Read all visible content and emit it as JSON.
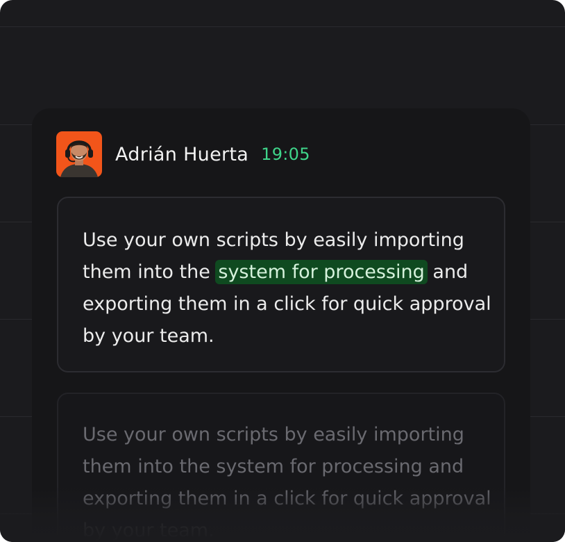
{
  "message": {
    "author": "Adrián Huerta",
    "time": "19:05",
    "text_before_highlight": "Use your own scripts by easily importing them into the ",
    "highlight": "system for processing",
    "text_after_highlight": " and exporting them in a click for quick approval by your team."
  },
  "ghost_message": {
    "text": "Use your own scripts by easily importing them into the system for processing and exporting them in a click for quick approval by your team."
  },
  "colors": {
    "background": "#1b1b1e",
    "panel": "#161618",
    "time_accent": "#3fd58a",
    "highlight_bg": "#0f4a20",
    "avatar_bg": "#f2551a"
  },
  "icons": {
    "avatar": "user-avatar-photo"
  }
}
